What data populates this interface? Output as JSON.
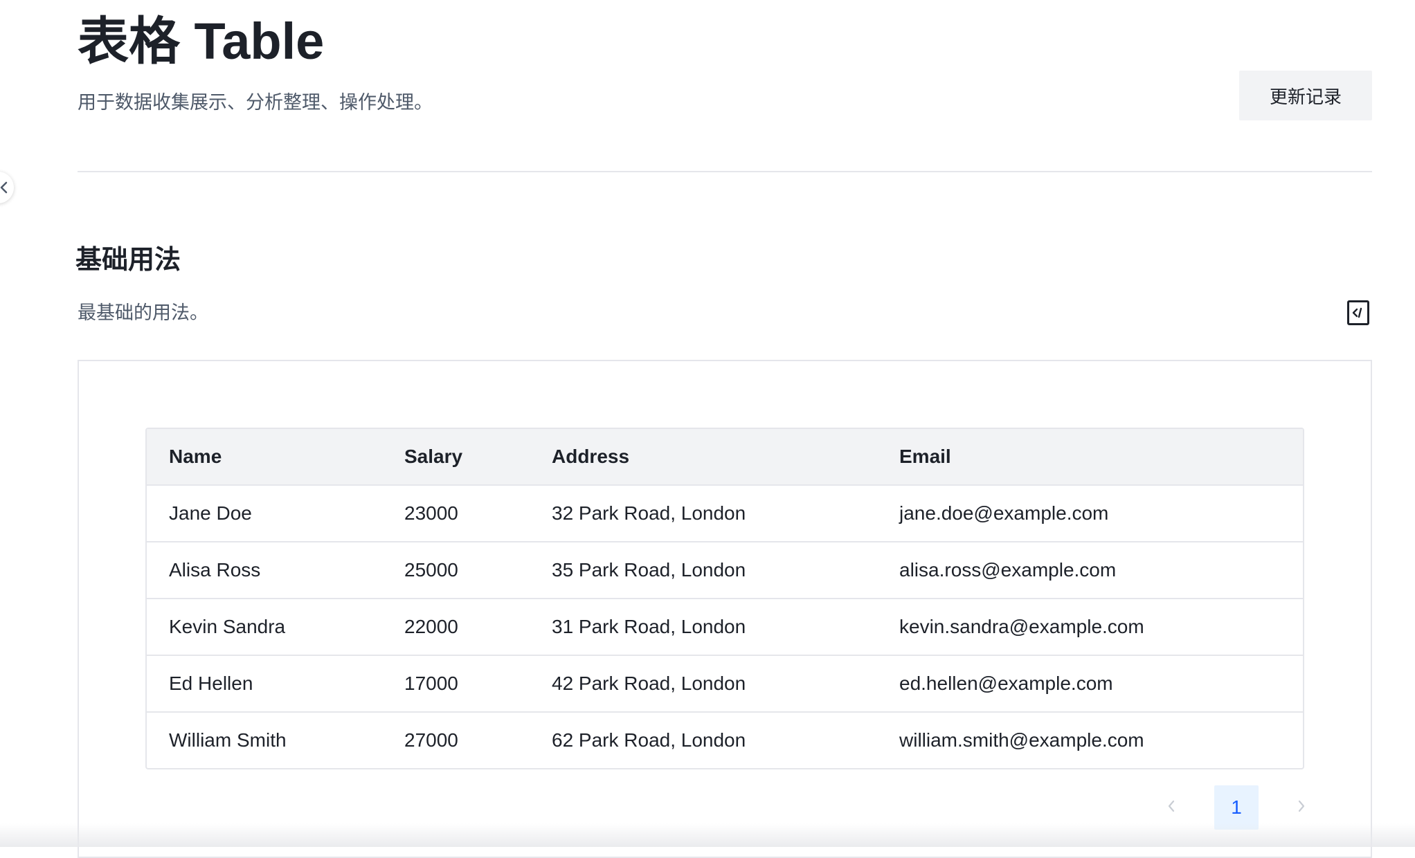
{
  "header": {
    "title": "表格 Table",
    "description": "用于数据收集展示、分析整理、操作处理。",
    "changelog_label": "更新记录"
  },
  "section": {
    "title": "基础用法",
    "description": "最基础的用法。"
  },
  "icons": {
    "collapse": "chevron-left-icon",
    "code": "code-icon",
    "prev": "chevron-left-icon",
    "next": "chevron-right-icon"
  },
  "table": {
    "columns": [
      "Name",
      "Salary",
      "Address",
      "Email"
    ],
    "rows": [
      [
        "Jane Doe",
        "23000",
        "32 Park Road, London",
        "jane.doe@example.com"
      ],
      [
        "Alisa Ross",
        "25000",
        "35 Park Road, London",
        "alisa.ross@example.com"
      ],
      [
        "Kevin Sandra",
        "22000",
        "31 Park Road, London",
        "kevin.sandra@example.com"
      ],
      [
        "Ed Hellen",
        "17000",
        "42 Park Road, London",
        "ed.hellen@example.com"
      ],
      [
        "William Smith",
        "27000",
        "62 Park Road, London",
        "william.smith@example.com"
      ]
    ]
  },
  "pagination": {
    "current_page": "1"
  },
  "colors": {
    "accent": "#165dff",
    "accent_bg": "#e8f3ff",
    "header_bg": "#f2f3f5",
    "border": "#e5e6eb",
    "text": "#1d2129",
    "secondary_text": "#4e5969",
    "disabled": "#c9cdd4"
  }
}
